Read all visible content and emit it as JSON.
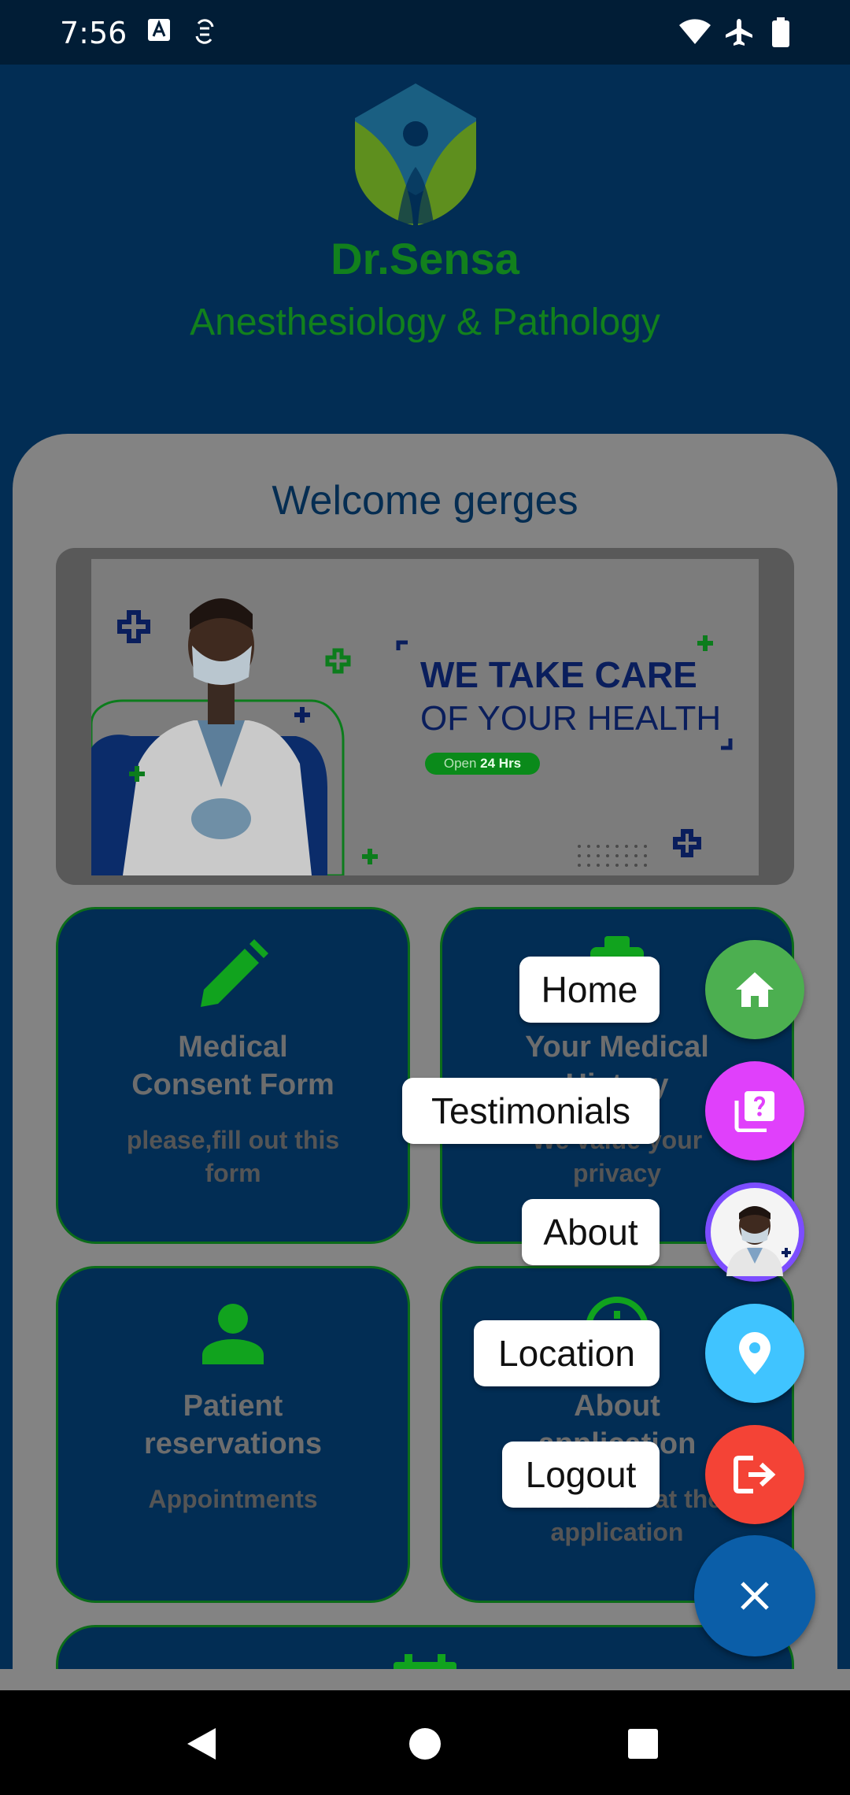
{
  "status": {
    "time": "7:56"
  },
  "brand": {
    "name": "Dr.Sensa",
    "subtitle": "Anesthesiology  & Pathology"
  },
  "welcome": "Welcome gerges",
  "banner": {
    "line1": "WE TAKE CARE",
    "line2": "OF YOUR HEALTH",
    "badge_prefix": "Open ",
    "badge_bold": "24 Hrs"
  },
  "cards": [
    {
      "icon": "pencil-icon",
      "title_1": "Medical",
      "title_2": "Consent Form",
      "sub_1": "please,fill out this",
      "sub_2": "form"
    },
    {
      "icon": "medical-history-icon",
      "title_1": "Your Medical",
      "title_2": "History",
      "sub_1": "We value your",
      "sub_2": "privacy"
    },
    {
      "icon": "person-icon",
      "title_1": "Patient",
      "title_2": "reservations",
      "sub_1": "Appointments",
      "sub_2": ""
    },
    {
      "icon": "info-icon",
      "title_1": "About",
      "title_2": "application",
      "sub_1": "Take a look at the",
      "sub_2": "application"
    }
  ],
  "fab_menu": [
    {
      "label": "Home",
      "icon": "home-icon",
      "color": "#4caf50"
    },
    {
      "label": "Testimonials",
      "icon": "testimonials-icon",
      "color": "#e040fb"
    },
    {
      "label": "About",
      "icon": "doctor-avatar",
      "color": "#7c4dff"
    },
    {
      "label": "Location",
      "icon": "location-pin-icon",
      "color": "#40c4ff"
    },
    {
      "label": "Logout",
      "icon": "logout-icon",
      "color": "#f44336"
    }
  ],
  "fab_close_icon": "close-icon",
  "colors": {
    "brand_green": "#12801d",
    "app_blue": "#022d54",
    "fab_main": "#0b5ea8"
  }
}
